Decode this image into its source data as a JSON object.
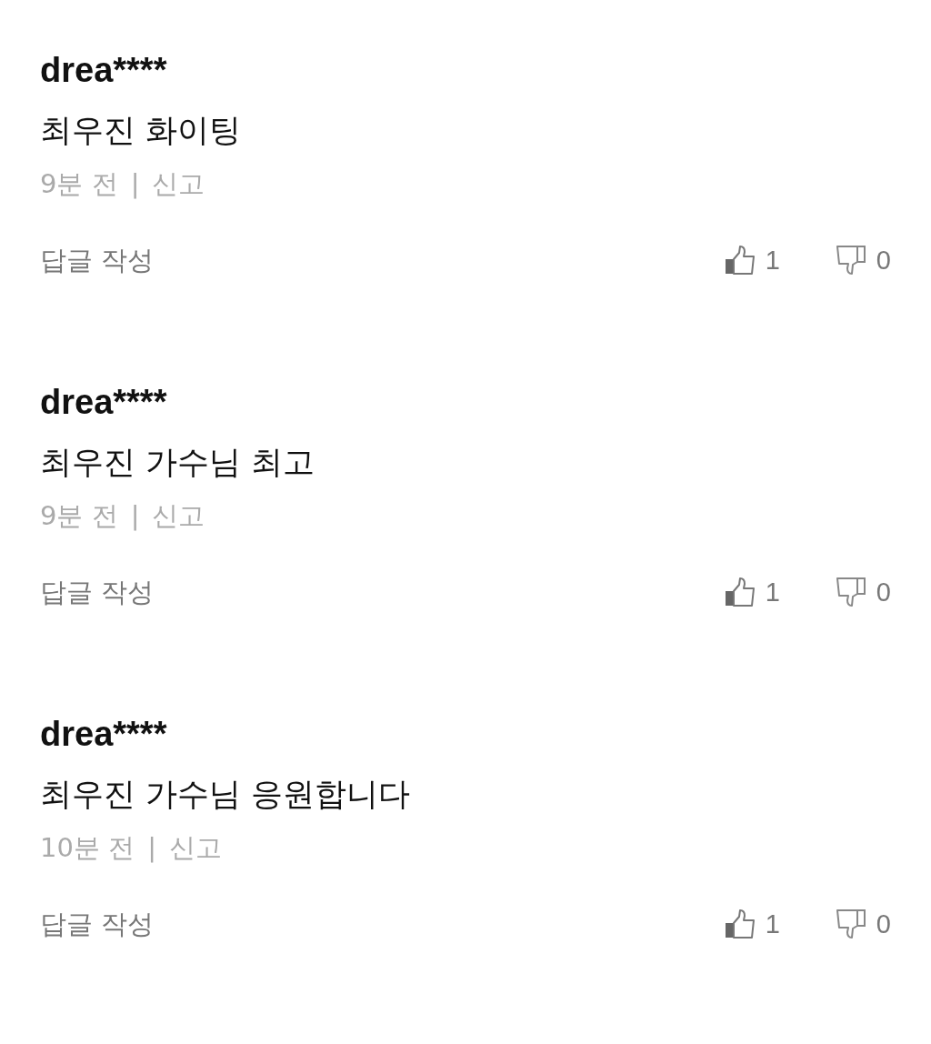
{
  "comments": [
    {
      "author": "drea****",
      "text": "최우진 화이팅",
      "time": "9분 전",
      "separator": "|",
      "report": "신고",
      "reply": "답글 작성",
      "likes": "1",
      "dislikes": "0"
    },
    {
      "author": "drea****",
      "text": "최우진 가수님 최고",
      "time": "9분 전",
      "separator": "|",
      "report": "신고",
      "reply": "답글 작성",
      "likes": "1",
      "dislikes": "0"
    },
    {
      "author": "drea****",
      "text": "최우진 가수님 응원합니다",
      "time": "10분 전",
      "separator": "|",
      "report": "신고",
      "reply": "답글 작성",
      "likes": "1",
      "dislikes": "0"
    }
  ]
}
